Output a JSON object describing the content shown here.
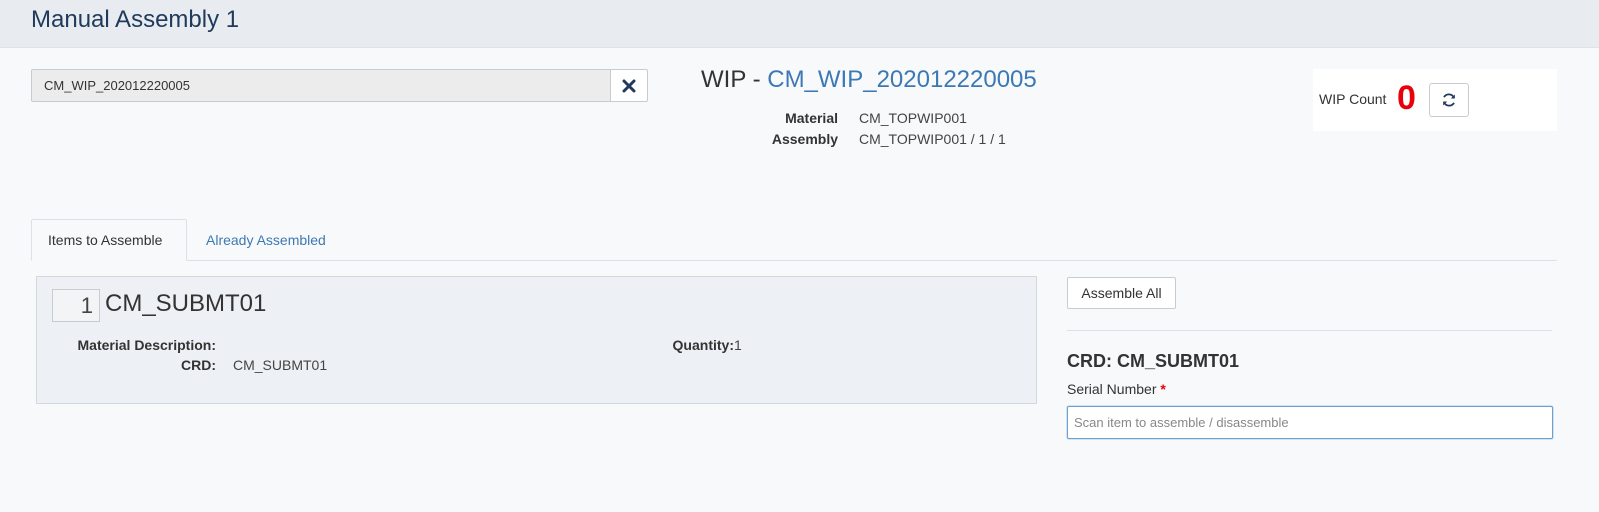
{
  "header": {
    "title": "Manual Assembly 1"
  },
  "scan": {
    "value": "CM_WIP_202012220005",
    "clear_icon": "close-icon"
  },
  "wip": {
    "prefix": "WIP - ",
    "id": "CM_WIP_202012220005",
    "material_label": "Material",
    "material_value": "CM_TOPWIP001",
    "assembly_label": "Assembly",
    "assembly_value": "CM_TOPWIP001 / 1 / 1"
  },
  "wip_count": {
    "label": "WIP Count",
    "value": "0",
    "refresh_icon": "refresh-icon",
    "value_color": "#e8000b"
  },
  "tabs": [
    {
      "label": "Items to Assemble",
      "active": true
    },
    {
      "label": "Already Assembled",
      "active": false
    }
  ],
  "item": {
    "quantity_input": "1",
    "name": "CM_SUBMT01",
    "material_description_label": "Material Description:",
    "material_description_value": "",
    "crd_label": "CRD:",
    "crd_value": "CM_SUBMT01",
    "quantity_label": "Quantity:",
    "quantity_value": "1"
  },
  "panel": {
    "assemble_all_label": "Assemble All",
    "crd_title": "CRD: CM_SUBMT01",
    "serial_label": "Serial Number",
    "required_mark": "*",
    "serial_placeholder": "Scan item to assemble / disassemble",
    "serial_value": ""
  },
  "colors": {
    "accent": "#3c79b4",
    "header_title": "#1f3a5a",
    "required": "#e8000b"
  }
}
